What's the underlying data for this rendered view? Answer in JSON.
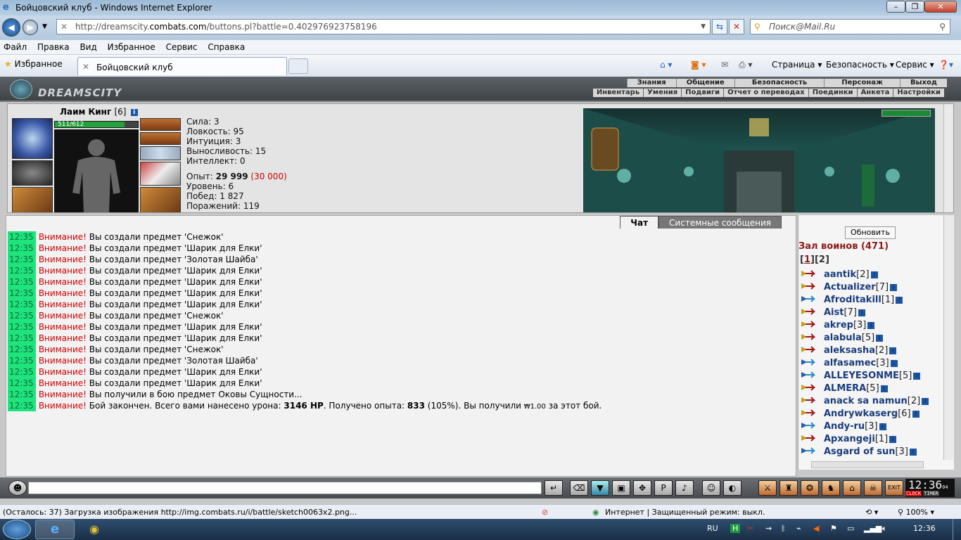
{
  "window": {
    "title": "Бойцовский клуб - Windows Internet Explorer"
  },
  "address": {
    "url_prefix": "http://dreamscity.",
    "url_domain": "combats.com",
    "url_suffix": "/buttons.pl?battle=0.402976923758196"
  },
  "search": {
    "placeholder": "Поиск@Mail.Ru"
  },
  "menu": [
    "Файл",
    "Правка",
    "Вид",
    "Избранное",
    "Сервис",
    "Справка"
  ],
  "favorites": {
    "label": "Избранное",
    "tab_title": "Бойцовский клуб"
  },
  "commandbar": {
    "page": "Страница",
    "safety": "Безопасность",
    "tools": "Сервис"
  },
  "game": {
    "logo": "DREAMSCITY",
    "top_menu": [
      "Знания",
      "Общение",
      "Безопасность",
      "Персонаж",
      "Выход"
    ],
    "sub_menu": [
      "Инвентарь",
      "Умения",
      "Подвиги",
      "Отчет о переводах",
      "Поединки",
      "Анкета",
      "Настройки"
    ],
    "character": {
      "name": "Лаим Кинг",
      "level": "[6]",
      "hp_text": "511/612",
      "hp_fraction": 0.835,
      "stats": [
        "Сила: 3",
        "Ловкость: 95",
        "Интуиция: 3",
        "Выносливость: 15",
        "Интеллект: 0"
      ],
      "exp_label": "Опыт:",
      "exp_value": "29 999",
      "exp_next": "(30 000)",
      "level_line": "Уровень: 6",
      "wins_line": "Побед: 1 827",
      "losses_line": "Поражений: 119"
    },
    "chat": {
      "tab_chat": "Чат",
      "tab_system": "Системные сообщения",
      "messages": [
        {
          "time": "12:35",
          "warn": "Внимание!",
          "text": " Вы создали предмет 'Снежок'"
        },
        {
          "time": "12:35",
          "warn": "Внимание!",
          "text": " Вы создали предмет 'Шарик для Елки'"
        },
        {
          "time": "12:35",
          "warn": "Внимание!",
          "text": " Вы создали предмет 'Золотая Шайба'"
        },
        {
          "time": "12:35",
          "warn": "Внимание!",
          "text": " Вы создали предмет 'Шарик для Елки'"
        },
        {
          "time": "12:35",
          "warn": "Внимание!",
          "text": " Вы создали предмет 'Шарик для Елки'"
        },
        {
          "time": "12:35",
          "warn": "Внимание!",
          "text": " Вы создали предмет 'Шарик для Елки'"
        },
        {
          "time": "12:35",
          "warn": "Внимание!",
          "text": " Вы создали предмет 'Шарик для Елки'"
        },
        {
          "time": "12:35",
          "warn": "Внимание!",
          "text": " Вы создали предмет 'Снежок'"
        },
        {
          "time": "12:35",
          "warn": "Внимание!",
          "text": " Вы создали предмет 'Шарик для Елки'"
        },
        {
          "time": "12:35",
          "warn": "Внимание!",
          "text": " Вы создали предмет 'Шарик для Елки'"
        },
        {
          "time": "12:35",
          "warn": "Внимание!",
          "text": " Вы создали предмет 'Снежок'"
        },
        {
          "time": "12:35",
          "warn": "Внимание!",
          "text": " Вы создали предмет 'Золотая Шайба'"
        },
        {
          "time": "12:35",
          "warn": "Внимание!",
          "text": " Вы создали предмет 'Шарик для Елки'"
        },
        {
          "time": "12:35",
          "warn": "Внимание!",
          "text": " Вы создали предмет 'Шарик для Елки'"
        },
        {
          "time": "12:35",
          "warn": "Внимание!",
          "text": " Вы получили в бою предмет Оковы Сущности..."
        }
      ],
      "final": {
        "time": "12:35",
        "warn": "Внимание!",
        "t1": " Бой закончен. Всего вами нанесено урона: ",
        "dmg": "3146 HP",
        "t2": ". Получено опыта: ",
        "exp": "833",
        "t3": " (105%). Вы получили ",
        "coin": "1.00",
        "t4": " за этот бой."
      }
    },
    "users": {
      "refresh": "Обновить",
      "hall": "Зал воинов (471)",
      "page_cur": "1",
      "page_other": "2",
      "list": [
        {
          "name": "aantik",
          "lvl": "[2]"
        },
        {
          "name": "Actualizer",
          "lvl": "[7]"
        },
        {
          "name": "Afroditakill",
          "lvl": "[1]"
        },
        {
          "name": "Aist",
          "lvl": "[7]"
        },
        {
          "name": "akrep",
          "lvl": "[3]"
        },
        {
          "name": "alabula",
          "lvl": "[5]"
        },
        {
          "name": "aleksasha",
          "lvl": "[2]"
        },
        {
          "name": "alfasamec",
          "lvl": "[3]"
        },
        {
          "name": "ALLEYESONME",
          "lvl": "[5]"
        },
        {
          "name": "ALMERA",
          "lvl": "[5]"
        },
        {
          "name": "anack sa namun",
          "lvl": "[2]"
        },
        {
          "name": "Andrywkaserg",
          "lvl": "[6]"
        },
        {
          "name": "Andy-ru",
          "lvl": "[3]"
        },
        {
          "name": "Apxangeji",
          "lvl": "[1]"
        },
        {
          "name": "Asgard of sun",
          "lvl": "[3]"
        }
      ]
    },
    "clock": {
      "time": "12:36",
      "sec": "04",
      "clock_label": "CLOCK",
      "timer_label": "TIMER"
    }
  },
  "status": {
    "loading": "(Осталось: 37) Загрузка изображения http://img.combats.ru/i/battle/sketch0063x2.png...",
    "zone": "Интернет | Защищенный режим: выкл.",
    "zoom": "100%"
  },
  "taskbar": {
    "lang": "RU",
    "time": "12:36"
  }
}
